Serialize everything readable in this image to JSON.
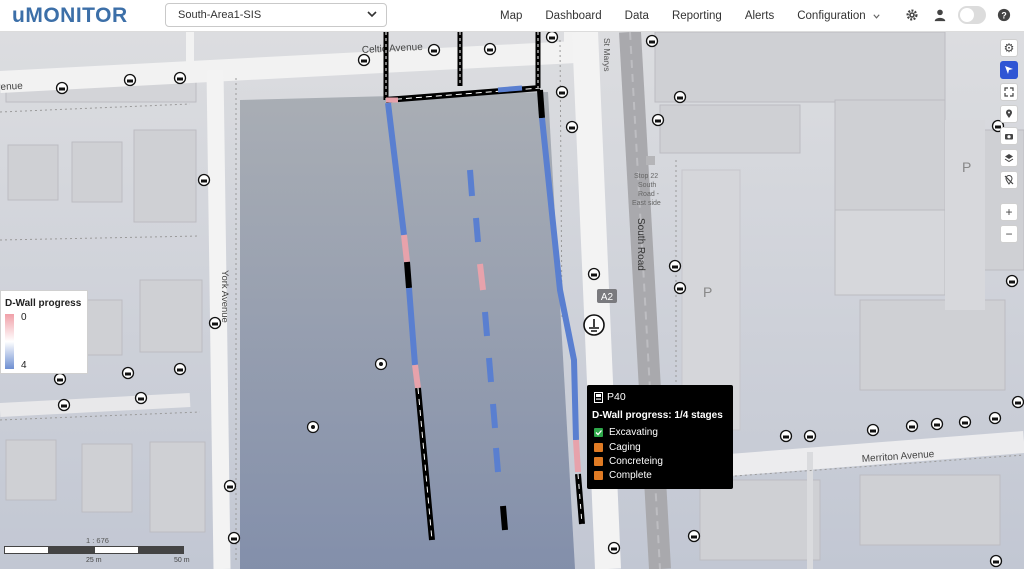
{
  "app": {
    "logo": "uMONITOR",
    "area_selector": "South-Area1-SIS"
  },
  "nav": {
    "items": [
      "Map",
      "Dashboard",
      "Data",
      "Reporting",
      "Alerts"
    ],
    "configuration": "Configuration"
  },
  "map": {
    "streets": {
      "celtic_avenue_top": "Celtic Avenue",
      "celtic_avenue_left": "Celtic Avenue",
      "york_avenue": "York Avenue",
      "st_marys": "St Marys",
      "south_road": "South Road",
      "merriton_avenue": "Merriton Avenue",
      "road_badge": "A2"
    },
    "bus_stop": {
      "line1": "Stop 22",
      "line2": "South",
      "line3": "Road -",
      "line4": "East side"
    },
    "parking": [
      "P",
      "P"
    ]
  },
  "legend": {
    "title": "D-Wall progress",
    "min": "0",
    "max": "4",
    "color_min": "#f0a0a8",
    "color_max": "#6e8fd2"
  },
  "popup": {
    "panel_id": "P40",
    "title": "D-Wall progress: 1/4 stages",
    "stages": [
      {
        "label": "Excavating",
        "status": "done",
        "color": "#2ea84a"
      },
      {
        "label": "Caging",
        "status": "pending",
        "color": "#e07b24"
      },
      {
        "label": "Concreteing",
        "status": "pending",
        "color": "#e07b24"
      },
      {
        "label": "Complete",
        "status": "pending",
        "color": "#e07b24"
      }
    ]
  },
  "scale": {
    "ratio": "1 : 676",
    "label_25": "25 m",
    "label_50": "50 m"
  },
  "colors": {
    "brand": "#3c6fa8",
    "active_tool": "#2f55d4",
    "wall_complete": "#5a7fd0",
    "wall_partial": "#e7a2ab",
    "wall_outline": "#000000"
  },
  "icons": {
    "settings": "gear-icon",
    "user": "user-icon",
    "help": "help-icon",
    "monitor_point": "monitor-point-icon"
  }
}
